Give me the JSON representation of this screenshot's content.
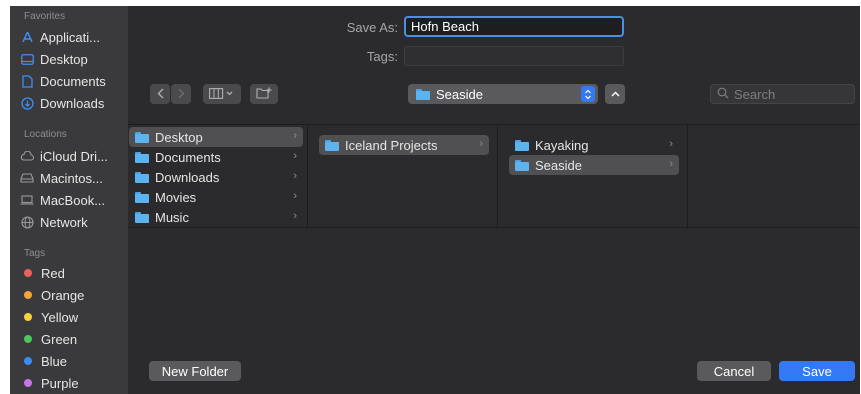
{
  "sidebar": {
    "favorites_header": "Favorites",
    "favorites": [
      {
        "label": "Applicati...",
        "icon": "applications-icon"
      },
      {
        "label": "Desktop",
        "icon": "desktop-icon"
      },
      {
        "label": "Documents",
        "icon": "document-icon"
      },
      {
        "label": "Downloads",
        "icon": "download-icon"
      }
    ],
    "locations_header": "Locations",
    "locations": [
      {
        "label": "iCloud Dri...",
        "icon": "cloud-icon"
      },
      {
        "label": "Macintos...",
        "icon": "disk-icon"
      },
      {
        "label": "MacBook...",
        "icon": "laptop-icon"
      },
      {
        "label": "Network",
        "icon": "globe-icon"
      }
    ],
    "tags_header": "Tags",
    "tags": [
      {
        "label": "Red",
        "color": "#ec5f5c"
      },
      {
        "label": "Orange",
        "color": "#f5a33a"
      },
      {
        "label": "Yellow",
        "color": "#f7d23b"
      },
      {
        "label": "Green",
        "color": "#4fc75b"
      },
      {
        "label": "Blue",
        "color": "#3a8bf5"
      },
      {
        "label": "Purple",
        "color": "#c774e8"
      }
    ]
  },
  "form": {
    "save_as_label": "Save As:",
    "save_as_value": "Hofn Beach",
    "tags_label": "Tags:"
  },
  "toolbar": {
    "location": "Seaside",
    "search_placeholder": "Search"
  },
  "columns": [
    [
      "Desktop",
      "Documents",
      "Downloads",
      "Movies",
      "Music"
    ],
    [
      "Iceland Projects"
    ],
    [
      "Kayaking",
      "Seaside"
    ]
  ],
  "buttons": {
    "new_folder": "New Folder",
    "cancel": "Cancel",
    "save": "Save"
  },
  "colors": {
    "accent": "#3478f6"
  }
}
